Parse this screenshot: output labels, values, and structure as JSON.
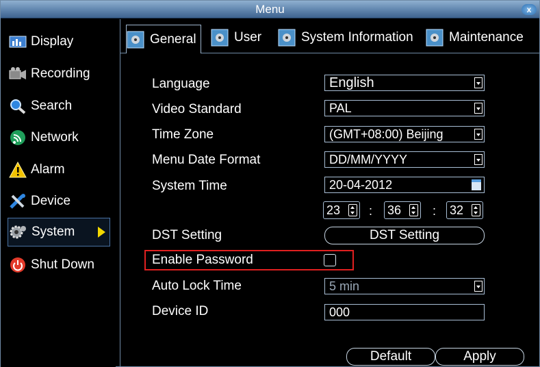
{
  "window": {
    "title": "Menu",
    "close_glyph": "x"
  },
  "sidebar": {
    "items": [
      {
        "label": "Display",
        "icon": "display-icon"
      },
      {
        "label": "Recording",
        "icon": "recording-icon"
      },
      {
        "label": "Search",
        "icon": "search-icon"
      },
      {
        "label": "Network",
        "icon": "network-icon"
      },
      {
        "label": "Alarm",
        "icon": "alarm-icon"
      },
      {
        "label": "Device",
        "icon": "device-icon"
      },
      {
        "label": "System",
        "icon": "gear-icon",
        "active": true
      },
      {
        "label": "Shut Down",
        "icon": "power-icon"
      }
    ]
  },
  "tabs": [
    {
      "label": "General",
      "active": true
    },
    {
      "label": "User"
    },
    {
      "label": "System Information"
    },
    {
      "label": "Maintenance"
    }
  ],
  "form": {
    "language": {
      "label": "Language",
      "value": "English"
    },
    "video_standard": {
      "label": "Video Standard",
      "value": "PAL"
    },
    "time_zone": {
      "label": "Time Zone",
      "value": "(GMT+08:00) Beijing"
    },
    "date_format": {
      "label": "Menu Date Format",
      "value": "DD/MM/YYYY"
    },
    "system_time": {
      "label": "System Time",
      "date": "20-04-2012",
      "hour": "23",
      "minute": "36",
      "second": "32",
      "separator": ":"
    },
    "dst": {
      "label": "DST Setting",
      "button": "DST Setting"
    },
    "enable_password": {
      "label": "Enable Password",
      "checked": false
    },
    "auto_lock": {
      "label": "Auto Lock Time",
      "value": "5 min"
    },
    "device_id": {
      "label": "Device ID",
      "value": "000"
    }
  },
  "footer": {
    "default_label": "Default",
    "apply_label": "Apply"
  },
  "colors": {
    "accent": "#4a72a3",
    "highlight_border": "#e02020",
    "active_arrow": "#f3d800"
  }
}
